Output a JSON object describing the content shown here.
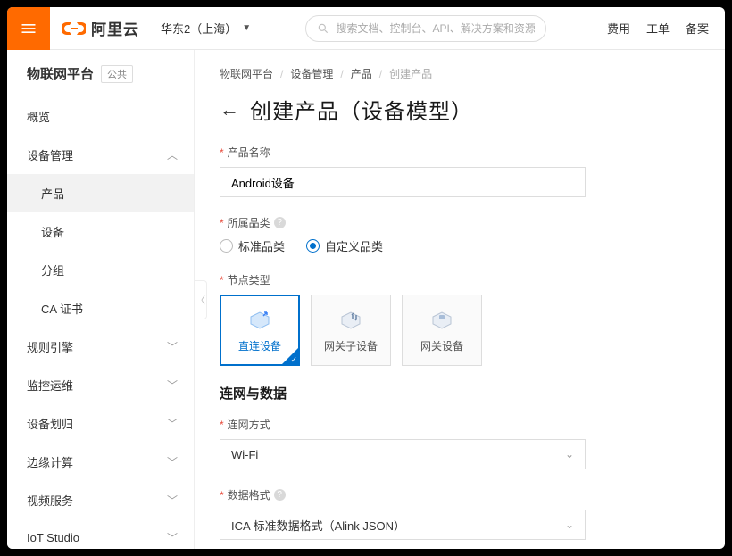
{
  "topbar": {
    "brand": "阿里云",
    "region": "华东2（上海）",
    "search_placeholder": "搜索文档、控制台、API、解决方案和资源",
    "links": {
      "fee": "费用",
      "ticket": "工单",
      "backup": "备案"
    }
  },
  "sidebar": {
    "title": "物联网平台",
    "badge": "公共",
    "items": {
      "overview": "概览",
      "device_mgmt": "设备管理",
      "device_mgmt_children": {
        "product": "产品",
        "device": "设备",
        "group": "分组",
        "ca": "CA 证书"
      },
      "rule_engine": "规则引擎",
      "monitor_ops": "监控运维",
      "device_dist": "设备划归",
      "edge_compute": "边缘计算",
      "video_service": "视频服务",
      "iot_studio": "IoT Studio"
    }
  },
  "breadcrumb": {
    "a": "物联网平台",
    "b": "设备管理",
    "c": "产品",
    "d": "创建产品"
  },
  "page": {
    "title": "创建产品（设备模型）"
  },
  "form": {
    "name_label": "产品名称",
    "name_value": "Android设备",
    "category_label": "所属品类",
    "category_std": "标准品类",
    "category_custom": "自定义品类",
    "node_label": "节点类型",
    "node_direct": "直连设备",
    "node_gw_sub": "网关子设备",
    "node_gw": "网关设备",
    "section_net": "连网与数据",
    "net_label": "连网方式",
    "net_value": "Wi-Fi",
    "data_label": "数据格式",
    "data_value": "ICA 标准数据格式（Alink JSON）"
  }
}
